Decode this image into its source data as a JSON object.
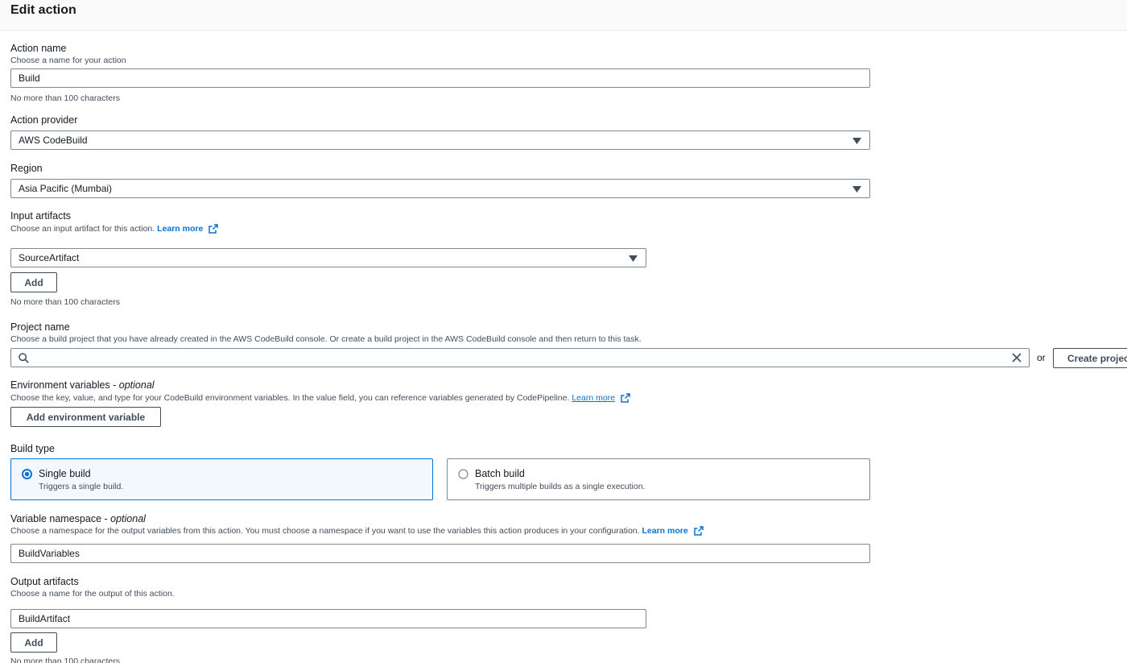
{
  "header": {
    "title": "Edit action"
  },
  "action_name": {
    "label": "Action name",
    "description": "Choose a name for your action",
    "value": "Build",
    "constraint": "No more than 100 characters"
  },
  "action_provider": {
    "label": "Action provider",
    "value": "AWS CodeBuild"
  },
  "region": {
    "label": "Region",
    "value": "Asia Pacific (Mumbai)"
  },
  "input_artifacts": {
    "label": "Input artifacts",
    "description": "Choose an input artifact for this action.",
    "learn_more": "Learn more",
    "value": "SourceArtifact",
    "add_label": "Add",
    "constraint": "No more than 100 characters"
  },
  "project_name": {
    "label": "Project name",
    "description": "Choose a build project that you have already created in the AWS CodeBuild console. Or create a build project in the AWS CodeBuild console and then return to this task.",
    "value": "",
    "or_text": "or",
    "create_label": "Create project"
  },
  "env_vars": {
    "label": "Environment variables",
    "optional": "optional",
    "description": "Choose the key, value, and type for your CodeBuild environment variables. In the value field, you can reference variables generated by CodePipeline.",
    "learn_more": "Learn more",
    "add_label": "Add environment variable"
  },
  "build_type": {
    "label": "Build type",
    "options": [
      {
        "title": "Single build",
        "description": "Triggers a single build.",
        "selected": true
      },
      {
        "title": "Batch build",
        "description": "Triggers multiple builds as a single execution.",
        "selected": false
      }
    ]
  },
  "variable_namespace": {
    "label": "Variable namespace",
    "optional": "optional",
    "description": "Choose a namespace for the output variables from this action. You must choose a namespace if you want to use the variables this action produces in your configuration.",
    "learn_more": "Learn more",
    "value": "BuildVariables"
  },
  "output_artifacts": {
    "label": "Output artifacts",
    "description": "Choose a name for the output of this action.",
    "value": "BuildArtifact",
    "add_label": "Add",
    "constraint": "No more than 100 characters"
  },
  "colors": {
    "link": "#0972d3",
    "selected_border": "#0972d3",
    "selected_bg": "#f2f8fd"
  }
}
